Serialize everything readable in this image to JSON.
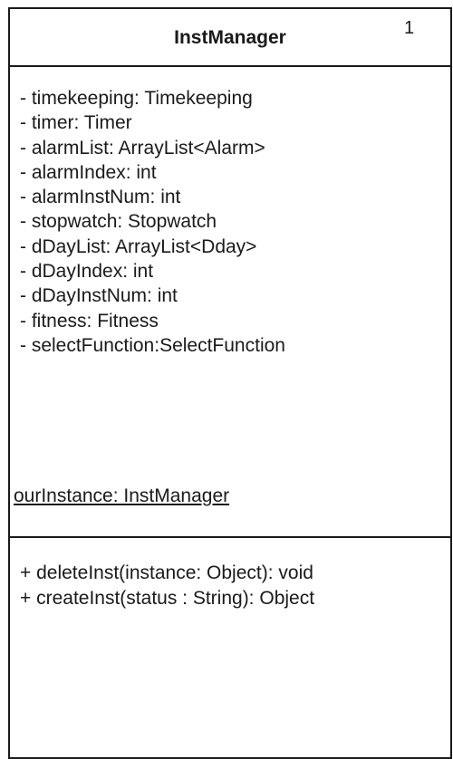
{
  "class": {
    "name": "InstManager",
    "multiplicity": "1",
    "attributes": [
      "- timekeeping: Timekeeping",
      "- timer: Timer",
      "- alarmList: ArrayList<Alarm>",
      "- alarmIndex: int",
      "- alarmInstNum: int",
      "- stopwatch: Stopwatch",
      "- dDayList: ArrayList<Dday>",
      "- dDayIndex: int",
      "- dDayInstNum: int",
      "- fitness: Fitness",
      "- selectFunction:SelectFunction"
    ],
    "static_attribute": "ourInstance: InstManager",
    "operations": [
      "+ deleteInst(instance: Object): void",
      "+ createInst(status : String): Object"
    ]
  }
}
